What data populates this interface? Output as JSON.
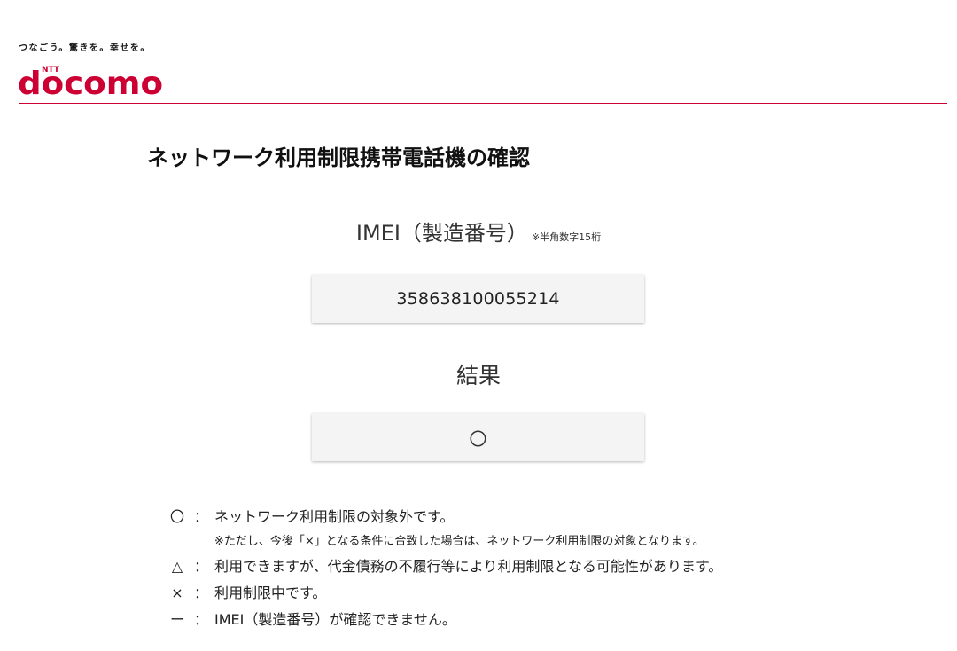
{
  "brand": {
    "tagline": "つなごう。驚きを。幸せを。",
    "logo_small": "NTT",
    "logo_text": "docomo",
    "brand_color": "#cc0033"
  },
  "page": {
    "title": "ネットワーク利用制限携帯電話機の確認"
  },
  "imei": {
    "label": "IMEI（製造番号）",
    "note": "※半角数字15桁",
    "value": "358638100055214"
  },
  "result": {
    "label": "結果",
    "value": "〇"
  },
  "legend": {
    "items": [
      {
        "symbol": "〇",
        "colon": "：",
        "text": "ネットワーク利用制限の対象外です。"
      },
      {
        "note": "※ただし、今後「×」となる条件に合致した場合は、ネットワーク利用制限の対象となります。"
      },
      {
        "symbol": "△",
        "colon": "：",
        "text": "利用できますが、代金債務の不履行等により利用制限となる可能性があります。"
      },
      {
        "symbol": "×",
        "colon": "：",
        "text": "利用制限中です。"
      },
      {
        "symbol": "ー",
        "colon": "：",
        "text": "IMEI（製造番号）が確認できません。"
      }
    ]
  }
}
